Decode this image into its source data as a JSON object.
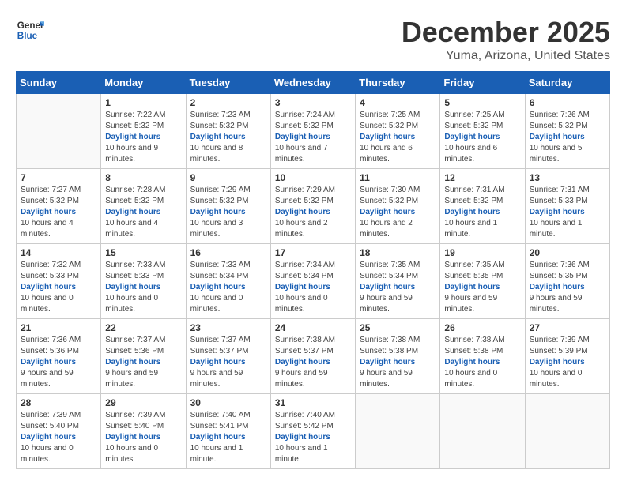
{
  "header": {
    "logo_line1": "General",
    "logo_line2": "Blue",
    "title": "December 2025",
    "subtitle": "Yuma, Arizona, United States"
  },
  "calendar": {
    "days_of_week": [
      "Sunday",
      "Monday",
      "Tuesday",
      "Wednesday",
      "Thursday",
      "Friday",
      "Saturday"
    ],
    "weeks": [
      [
        {
          "num": "",
          "info": ""
        },
        {
          "num": "1",
          "sunrise": "Sunrise: 7:22 AM",
          "sunset": "Sunset: 5:32 PM",
          "daylight": "Daylight: 10 hours and 9 minutes."
        },
        {
          "num": "2",
          "sunrise": "Sunrise: 7:23 AM",
          "sunset": "Sunset: 5:32 PM",
          "daylight": "Daylight: 10 hours and 8 minutes."
        },
        {
          "num": "3",
          "sunrise": "Sunrise: 7:24 AM",
          "sunset": "Sunset: 5:32 PM",
          "daylight": "Daylight: 10 hours and 7 minutes."
        },
        {
          "num": "4",
          "sunrise": "Sunrise: 7:25 AM",
          "sunset": "Sunset: 5:32 PM",
          "daylight": "Daylight: 10 hours and 6 minutes."
        },
        {
          "num": "5",
          "sunrise": "Sunrise: 7:25 AM",
          "sunset": "Sunset: 5:32 PM",
          "daylight": "Daylight: 10 hours and 6 minutes."
        },
        {
          "num": "6",
          "sunrise": "Sunrise: 7:26 AM",
          "sunset": "Sunset: 5:32 PM",
          "daylight": "Daylight: 10 hours and 5 minutes."
        }
      ],
      [
        {
          "num": "7",
          "sunrise": "Sunrise: 7:27 AM",
          "sunset": "Sunset: 5:32 PM",
          "daylight": "Daylight: 10 hours and 4 minutes."
        },
        {
          "num": "8",
          "sunrise": "Sunrise: 7:28 AM",
          "sunset": "Sunset: 5:32 PM",
          "daylight": "Daylight: 10 hours and 4 minutes."
        },
        {
          "num": "9",
          "sunrise": "Sunrise: 7:29 AM",
          "sunset": "Sunset: 5:32 PM",
          "daylight": "Daylight: 10 hours and 3 minutes."
        },
        {
          "num": "10",
          "sunrise": "Sunrise: 7:29 AM",
          "sunset": "Sunset: 5:32 PM",
          "daylight": "Daylight: 10 hours and 2 minutes."
        },
        {
          "num": "11",
          "sunrise": "Sunrise: 7:30 AM",
          "sunset": "Sunset: 5:32 PM",
          "daylight": "Daylight: 10 hours and 2 minutes."
        },
        {
          "num": "12",
          "sunrise": "Sunrise: 7:31 AM",
          "sunset": "Sunset: 5:32 PM",
          "daylight": "Daylight: 10 hours and 1 minute."
        },
        {
          "num": "13",
          "sunrise": "Sunrise: 7:31 AM",
          "sunset": "Sunset: 5:33 PM",
          "daylight": "Daylight: 10 hours and 1 minute."
        }
      ],
      [
        {
          "num": "14",
          "sunrise": "Sunrise: 7:32 AM",
          "sunset": "Sunset: 5:33 PM",
          "daylight": "Daylight: 10 hours and 0 minutes."
        },
        {
          "num": "15",
          "sunrise": "Sunrise: 7:33 AM",
          "sunset": "Sunset: 5:33 PM",
          "daylight": "Daylight: 10 hours and 0 minutes."
        },
        {
          "num": "16",
          "sunrise": "Sunrise: 7:33 AM",
          "sunset": "Sunset: 5:34 PM",
          "daylight": "Daylight: 10 hours and 0 minutes."
        },
        {
          "num": "17",
          "sunrise": "Sunrise: 7:34 AM",
          "sunset": "Sunset: 5:34 PM",
          "daylight": "Daylight: 10 hours and 0 minutes."
        },
        {
          "num": "18",
          "sunrise": "Sunrise: 7:35 AM",
          "sunset": "Sunset: 5:34 PM",
          "daylight": "Daylight: 9 hours and 59 minutes."
        },
        {
          "num": "19",
          "sunrise": "Sunrise: 7:35 AM",
          "sunset": "Sunset: 5:35 PM",
          "daylight": "Daylight: 9 hours and 59 minutes."
        },
        {
          "num": "20",
          "sunrise": "Sunrise: 7:36 AM",
          "sunset": "Sunset: 5:35 PM",
          "daylight": "Daylight: 9 hours and 59 minutes."
        }
      ],
      [
        {
          "num": "21",
          "sunrise": "Sunrise: 7:36 AM",
          "sunset": "Sunset: 5:36 PM",
          "daylight": "Daylight: 9 hours and 59 minutes."
        },
        {
          "num": "22",
          "sunrise": "Sunrise: 7:37 AM",
          "sunset": "Sunset: 5:36 PM",
          "daylight": "Daylight: 9 hours and 59 minutes."
        },
        {
          "num": "23",
          "sunrise": "Sunrise: 7:37 AM",
          "sunset": "Sunset: 5:37 PM",
          "daylight": "Daylight: 9 hours and 59 minutes."
        },
        {
          "num": "24",
          "sunrise": "Sunrise: 7:38 AM",
          "sunset": "Sunset: 5:37 PM",
          "daylight": "Daylight: 9 hours and 59 minutes."
        },
        {
          "num": "25",
          "sunrise": "Sunrise: 7:38 AM",
          "sunset": "Sunset: 5:38 PM",
          "daylight": "Daylight: 9 hours and 59 minutes."
        },
        {
          "num": "26",
          "sunrise": "Sunrise: 7:38 AM",
          "sunset": "Sunset: 5:38 PM",
          "daylight": "Daylight: 10 hours and 0 minutes."
        },
        {
          "num": "27",
          "sunrise": "Sunrise: 7:39 AM",
          "sunset": "Sunset: 5:39 PM",
          "daylight": "Daylight: 10 hours and 0 minutes."
        }
      ],
      [
        {
          "num": "28",
          "sunrise": "Sunrise: 7:39 AM",
          "sunset": "Sunset: 5:40 PM",
          "daylight": "Daylight: 10 hours and 0 minutes."
        },
        {
          "num": "29",
          "sunrise": "Sunrise: 7:39 AM",
          "sunset": "Sunset: 5:40 PM",
          "daylight": "Daylight: 10 hours and 0 minutes."
        },
        {
          "num": "30",
          "sunrise": "Sunrise: 7:40 AM",
          "sunset": "Sunset: 5:41 PM",
          "daylight": "Daylight: 10 hours and 1 minute."
        },
        {
          "num": "31",
          "sunrise": "Sunrise: 7:40 AM",
          "sunset": "Sunset: 5:42 PM",
          "daylight": "Daylight: 10 hours and 1 minute."
        },
        {
          "num": "",
          "info": ""
        },
        {
          "num": "",
          "info": ""
        },
        {
          "num": "",
          "info": ""
        }
      ]
    ]
  }
}
